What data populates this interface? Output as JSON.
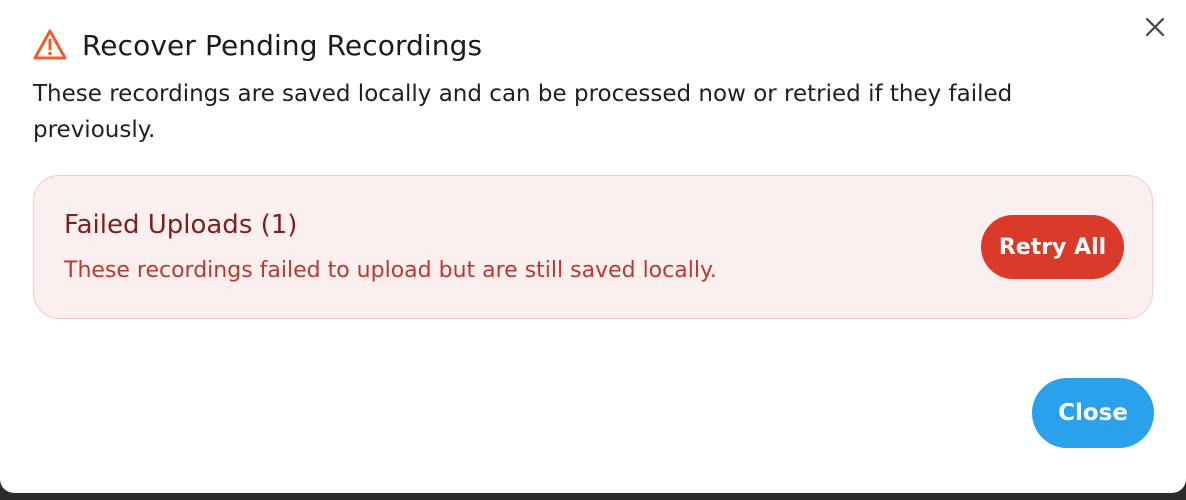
{
  "dialog": {
    "title": "Recover Pending Recordings",
    "description": "These recordings are saved locally and can be processed now or retried if they failed previously.",
    "icons": {
      "title_icon": "warning-triangle-icon",
      "close_icon": "close-icon"
    },
    "colors": {
      "warning_orange": "#e8612c",
      "panel_bg": "#fcefef",
      "panel_border": "#f7c9c9",
      "danger_red": "#d93a2a",
      "primary_blue": "#2aa1ea",
      "heading_dark_red": "#7b1f1f",
      "text_red": "#b83a2f"
    }
  },
  "failed_uploads": {
    "heading": "Failed Uploads (1)",
    "text": "These recordings failed to upload but are still saved locally.",
    "retry_label": "Retry All"
  },
  "footer": {
    "close_label": "Close"
  }
}
